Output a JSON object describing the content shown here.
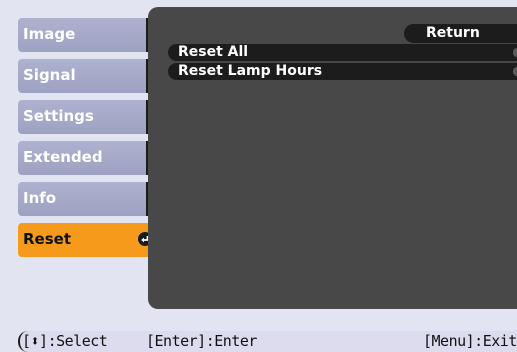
{
  "menu": {
    "items": [
      {
        "label": "Image"
      },
      {
        "label": "Signal"
      },
      {
        "label": "Settings"
      },
      {
        "label": "Extended"
      },
      {
        "label": "Info"
      },
      {
        "label": "Reset",
        "active": true
      }
    ]
  },
  "panel": {
    "return_label": "Return",
    "options": [
      {
        "label": "Reset All"
      },
      {
        "label": "Reset Lamp Hours"
      }
    ]
  },
  "help": {
    "select": "[⬍]:Select",
    "enter": "[Enter]:Enter",
    "exit": "[Menu]:Exit"
  },
  "colors": {
    "active_tab": "#f59a1b",
    "inactive_tab": "#a6aacb",
    "panel": "#484848"
  }
}
